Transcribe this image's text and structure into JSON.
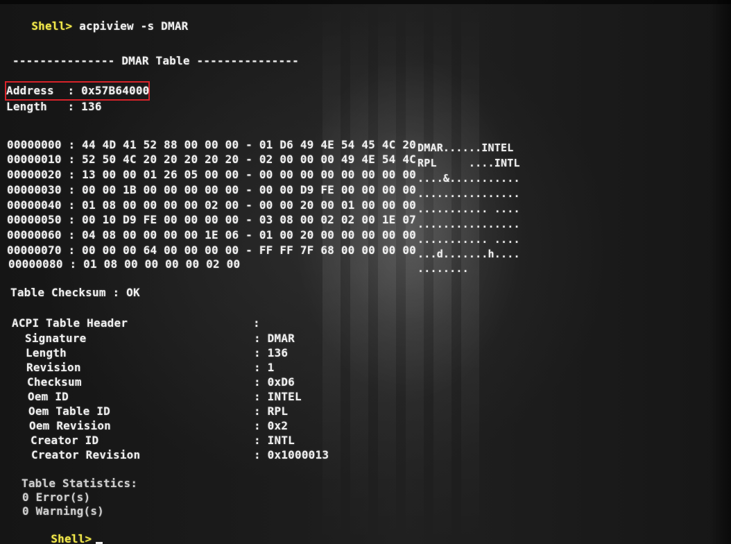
{
  "command": {
    "prompt": "Shell>",
    "text": "acpiview -s DMAR"
  },
  "table_title": "--------------- DMAR Table ---------------",
  "address_line": "Address  : 0x57B64000",
  "length_line": "Length   : 136",
  "hex_dump": [
    {
      "offset": "00000000 :",
      "bytes": "44 4D 41 52 88 00 00 00 - 01 D6 49 4E 54 45 4C 20",
      "ascii": "DMAR......INTEL"
    },
    {
      "offset": "00000010 :",
      "bytes": "52 50 4C 20 20 20 20 20 - 02 00 00 00 49 4E 54 4C",
      "ascii": "RPL     ....INTL"
    },
    {
      "offset": "00000020 :",
      "bytes": "13 00 00 01 26 05 00 00 - 00 00 00 00 00 00 00 00",
      "ascii": "....&..........."
    },
    {
      "offset": "00000030 :",
      "bytes": "00 00 1B 00 00 00 00 00 - 00 00 D9 FE 00 00 00 00",
      "ascii": "................"
    },
    {
      "offset": "00000040 :",
      "bytes": "01 08 00 00 00 00 02 00 - 00 00 20 00 01 00 00 00",
      "ascii": "........... ...."
    },
    {
      "offset": "00000050 :",
      "bytes": "00 10 D9 FE 00 00 00 00 - 03 08 00 02 02 00 1E 07",
      "ascii": "................"
    },
    {
      "offset": "00000060 :",
      "bytes": "04 08 00 00 00 00 1E 06 - 01 00 20 00 00 00 00 00",
      "ascii": "........... ...."
    },
    {
      "offset": "00000070 :",
      "bytes": "00 00 00 64 00 00 00 00 - FF FF 7F 68 00 00 00 00",
      "ascii": "...d.......h...."
    },
    {
      "offset": "00000080 :",
      "bytes": "01 08 00 00 00 00 02 00",
      "ascii": "........"
    }
  ],
  "checksum_line": "Table Checksum : OK",
  "header": {
    "title": "ACPI Table Header",
    "rows": [
      {
        "label": "Signature",
        "value": "DMAR"
      },
      {
        "label": "Length",
        "value": "136"
      },
      {
        "label": "Revision",
        "value": "1"
      },
      {
        "label": "Checksum",
        "value": "0xD6"
      },
      {
        "label": "Oem ID",
        "value": "INTEL"
      },
      {
        "label": "Oem Table ID",
        "value": "RPL"
      },
      {
        "label": "Oem Revision",
        "value": "0x2"
      },
      {
        "label": "Creator ID",
        "value": "INTL"
      },
      {
        "label": "Creator Revision",
        "value": "0x1000013"
      }
    ]
  },
  "statistics": {
    "title": "Table Statistics:",
    "errors": "0 Error(s)",
    "warnings": "0 Warning(s)"
  },
  "final_prompt": "Shell>",
  "colors": {
    "prompt": "#f2e84a",
    "text": "#f0f0f0",
    "highlight": "#d8232a",
    "background": "#101010"
  }
}
